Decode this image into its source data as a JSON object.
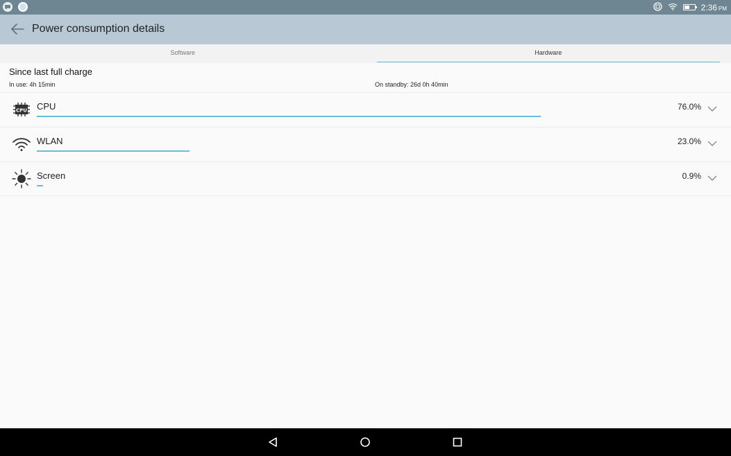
{
  "status_bar": {
    "time": "2:36",
    "ampm": "PM",
    "icons": [
      "chat-notification-icon",
      "app-notification-icon",
      "sync-icon",
      "wifi-icon",
      "battery-icon"
    ]
  },
  "app_bar": {
    "title": "Power consumption details",
    "back_icon": "arrow-left-icon"
  },
  "tabs": [
    {
      "label": "Software",
      "active": false
    },
    {
      "label": "Hardware",
      "active": true
    }
  ],
  "summary": {
    "title": "Since last full charge",
    "in_use": "In use: 4h 15min",
    "on_standby": "On standby: 26d 0h 40min"
  },
  "items": [
    {
      "label": "CPU",
      "value": "76.0%",
      "icon": "cpu-icon",
      "usage_fraction": 0.76
    },
    {
      "label": "WLAN",
      "value": "23.0%",
      "icon": "wifi-icon",
      "usage_fraction": 0.23
    },
    {
      "label": "Screen",
      "value": "0.9%",
      "icon": "brightness-icon",
      "usage_fraction": 0.009
    }
  ],
  "nav_bar": {
    "buttons": [
      "back-triangle-icon",
      "home-circle-icon",
      "recents-square-icon"
    ]
  },
  "colors": {
    "status_bar": "#6e8592",
    "app_bar": "#b8c8d5",
    "accent": "#5fb8d6",
    "background": "#fafafa"
  }
}
